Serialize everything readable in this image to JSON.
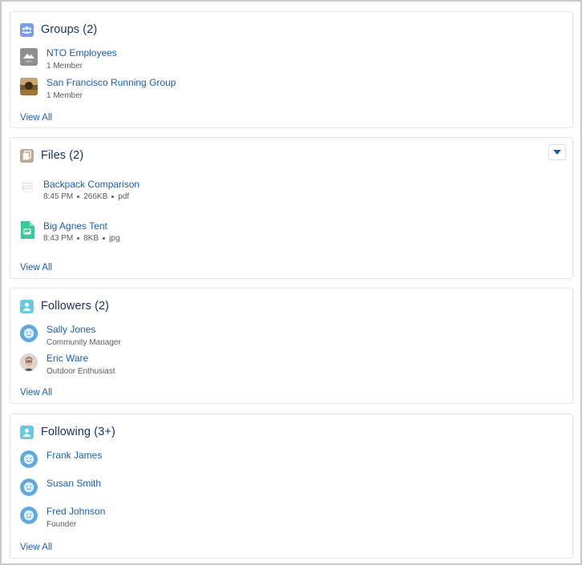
{
  "groups": {
    "title": "Groups (2)",
    "items": [
      {
        "name": "NTO Employees",
        "members": "1 Member",
        "logo_text": "NTO"
      },
      {
        "name": "San Francisco Running Group",
        "members": "1 Member"
      }
    ],
    "view_all": "View All",
    "icon": "groups-icon",
    "icon_color": "#779ef2"
  },
  "files": {
    "title": "Files (2)",
    "items": [
      {
        "name": "Backpack Comparison",
        "time": "8:45 PM",
        "size": "266KB",
        "type": "pdf"
      },
      {
        "name": "Big Agnes Tent",
        "time": "8:43 PM",
        "size": "8KB",
        "type": "jpg"
      }
    ],
    "view_all": "View All",
    "icon": "files-icon",
    "icon_color": "#baac93"
  },
  "followers": {
    "title": "Followers (2)",
    "items": [
      {
        "name": "Sally Jones",
        "role": "Community Manager"
      },
      {
        "name": "Eric Ware",
        "role": "Outdoor Enthusiast"
      }
    ],
    "view_all": "View All",
    "icon": "person-icon",
    "icon_color": "#65cae4"
  },
  "following": {
    "title": "Following (3+)",
    "items": [
      {
        "name": "Frank James",
        "role": ""
      },
      {
        "name": "Susan Smith",
        "role": ""
      },
      {
        "name": "Fred Johnson",
        "role": "Founder"
      }
    ],
    "view_all": "View All",
    "icon": "person-icon",
    "icon_color": "#65cae4"
  }
}
